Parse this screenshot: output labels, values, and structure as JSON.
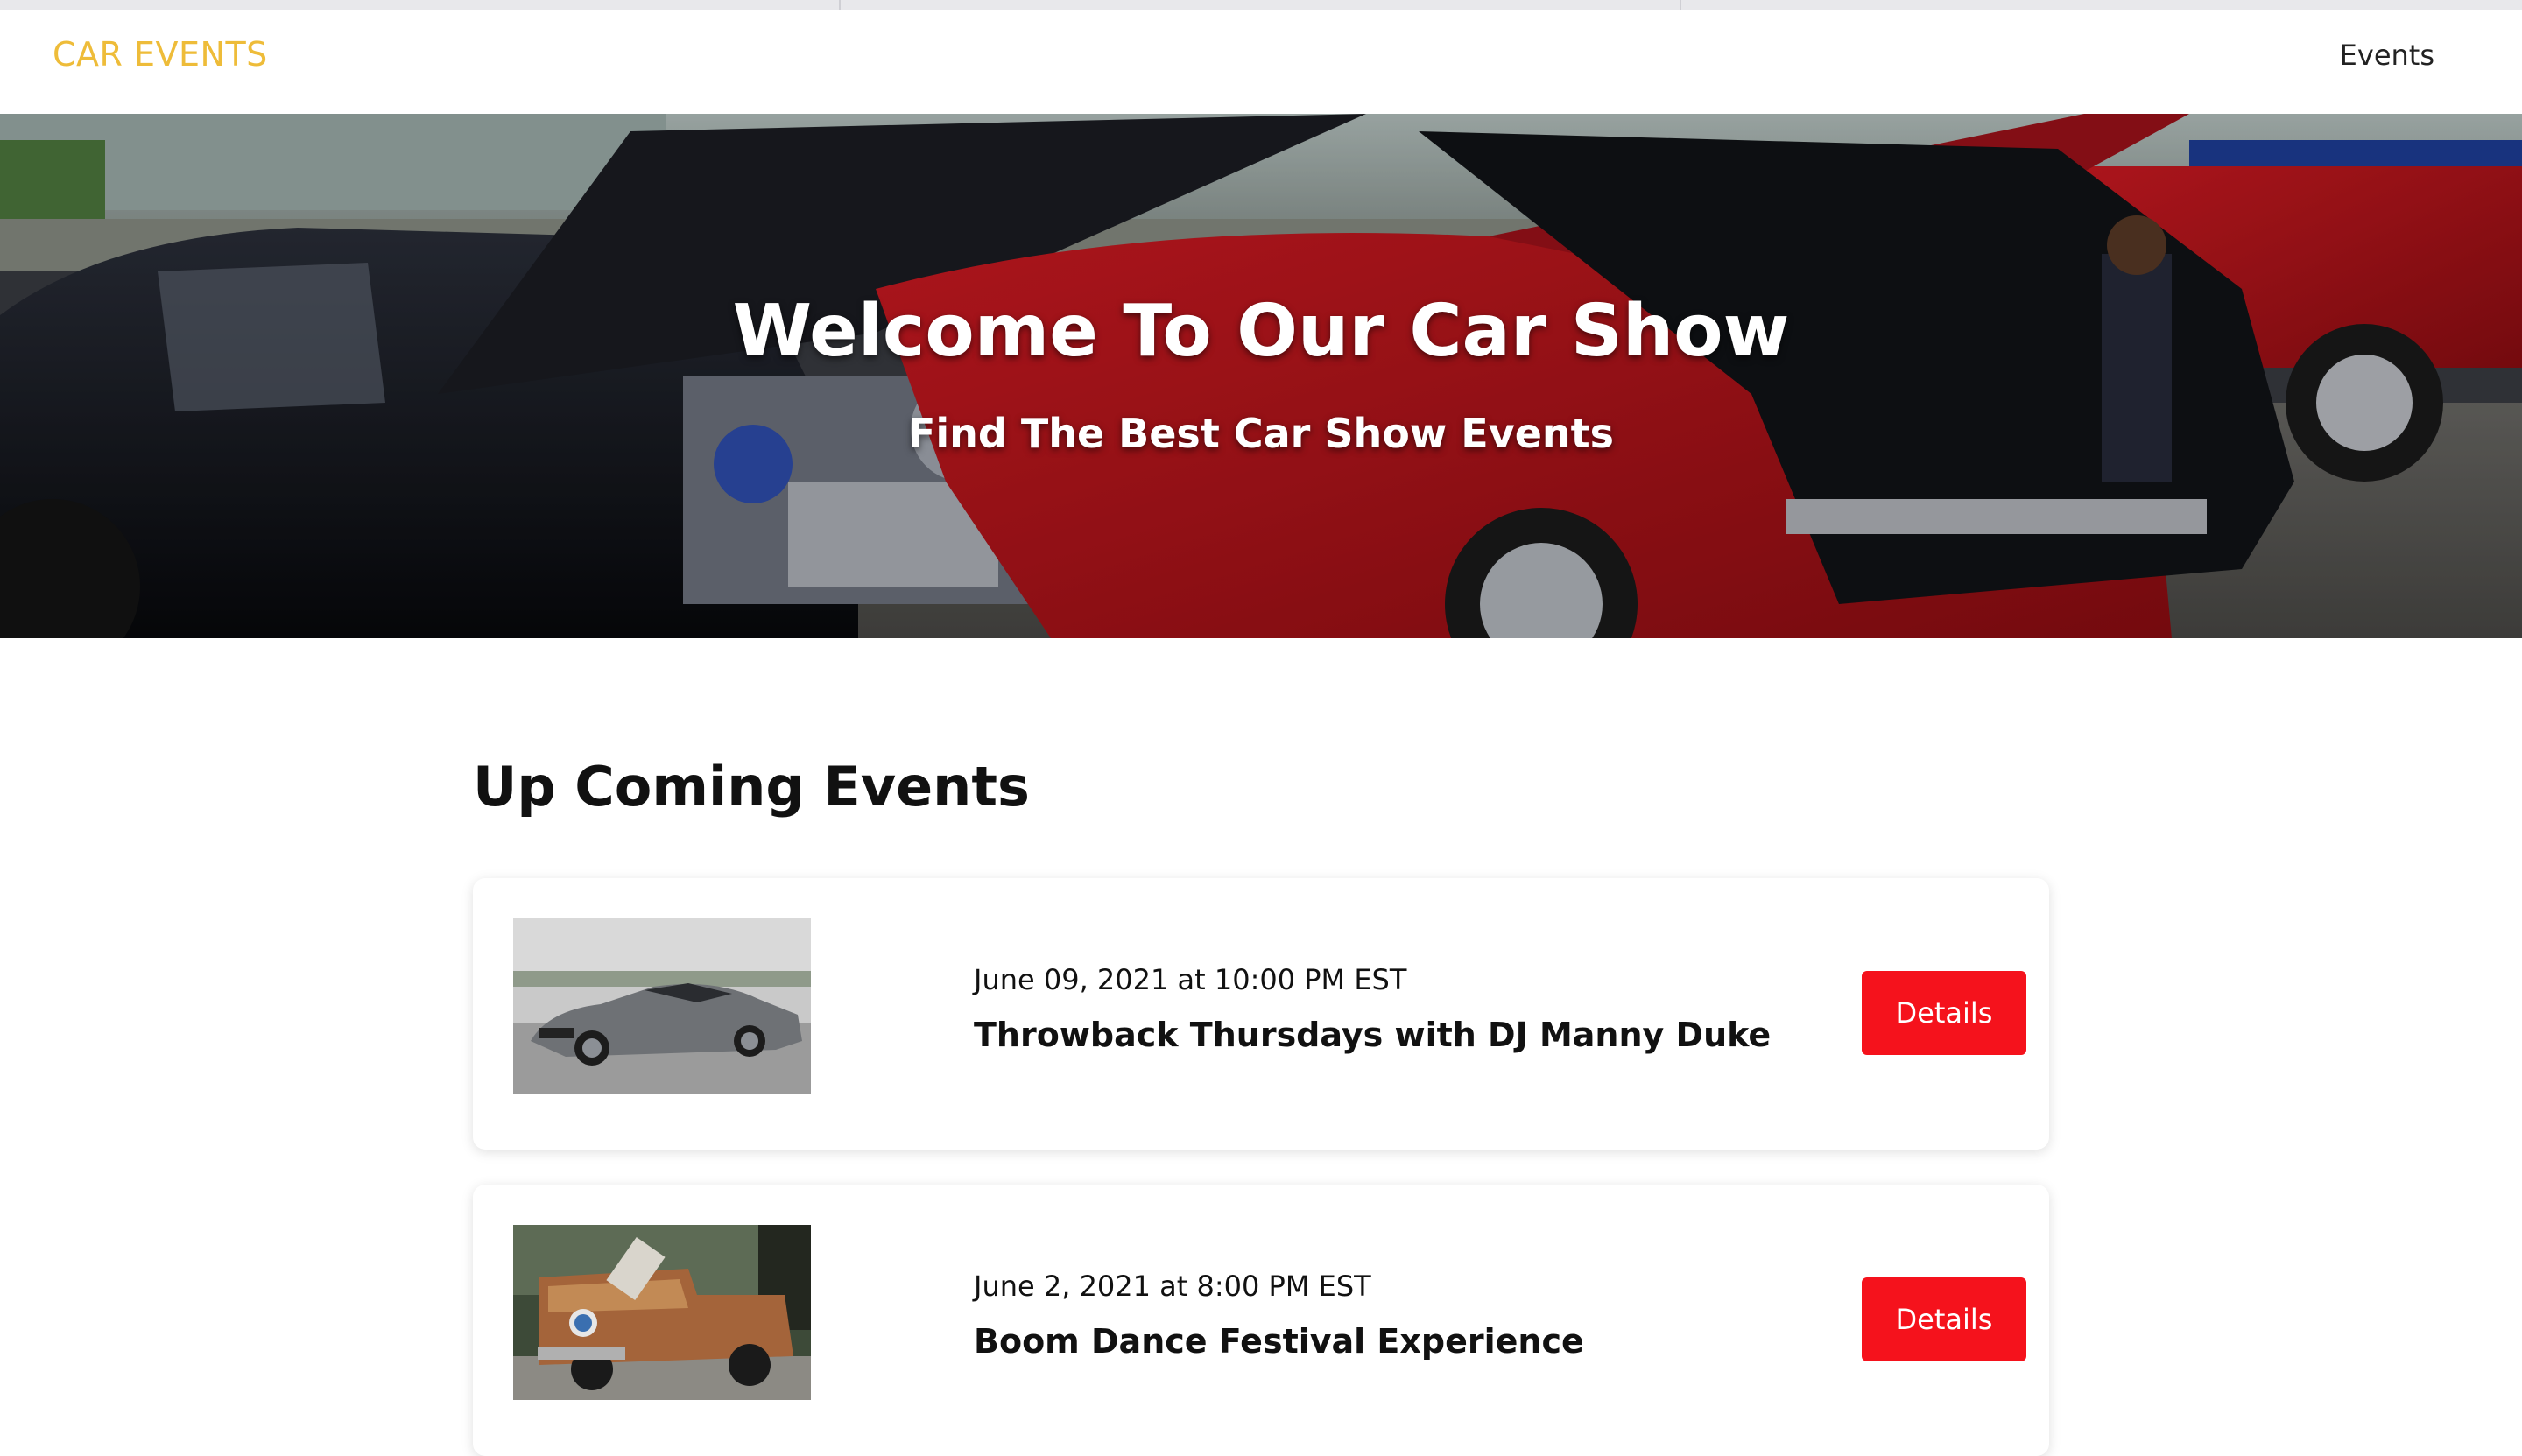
{
  "navbar": {
    "brand": "CAR EVENTS",
    "links": [
      "Events"
    ]
  },
  "hero": {
    "title": "Welcome To Our Car Show",
    "subtitle": "Find The Best Car Show Events"
  },
  "events_section": {
    "heading": "Up Coming Events",
    "events": [
      {
        "date": "June 09, 2021 at 10:00 PM EST",
        "title": "Throwback Thursdays with DJ Manny Duke",
        "button_label": "Details"
      },
      {
        "date": "June 2, 2021 at 8:00 PM EST",
        "title": "Boom Dance Festival Experience",
        "button_label": "Details"
      }
    ]
  },
  "colors": {
    "brand": "#eebc39",
    "accent_button": "#f5121c"
  }
}
